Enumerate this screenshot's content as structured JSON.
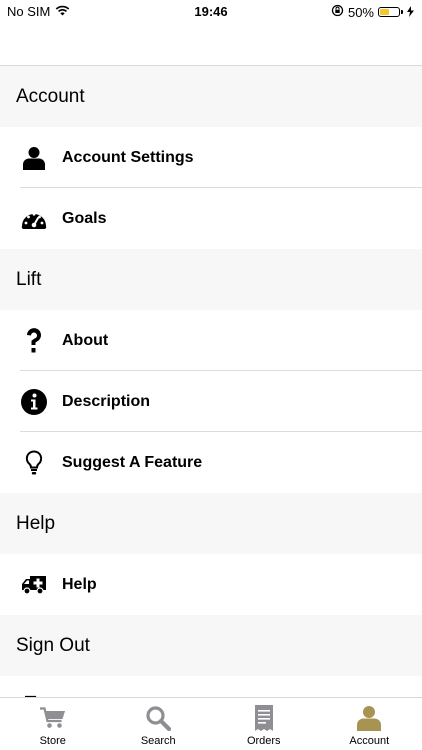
{
  "status": {
    "carrier": "No SIM",
    "time": "19:46",
    "battery": "50%",
    "battery_level": 0.5
  },
  "sections": [
    {
      "header": "Account",
      "items": [
        {
          "icon": "user-icon",
          "label": "Account Settings"
        },
        {
          "icon": "speedometer-icon",
          "label": "Goals"
        }
      ]
    },
    {
      "header": "Lift",
      "items": [
        {
          "icon": "question-mark-icon",
          "label": "About"
        },
        {
          "icon": "info-icon",
          "label": "Description"
        },
        {
          "icon": "lightbulb-icon",
          "label": "Suggest A Feature"
        }
      ]
    },
    {
      "header": "Help",
      "items": [
        {
          "icon": "ambulance-icon",
          "label": "Help"
        }
      ]
    },
    {
      "header": "Sign Out",
      "items": []
    }
  ],
  "tabs": [
    {
      "label": "Store",
      "icon": "cart-icon",
      "active": false
    },
    {
      "label": "Search",
      "icon": "search-icon",
      "active": false
    },
    {
      "label": "Orders",
      "icon": "receipt-icon",
      "active": false
    },
    {
      "label": "Account",
      "icon": "user-icon",
      "active": true
    }
  ],
  "colors": {
    "active": "#a89452",
    "inactive": "#8e8e93",
    "section_bg": "#f7f7f7"
  }
}
